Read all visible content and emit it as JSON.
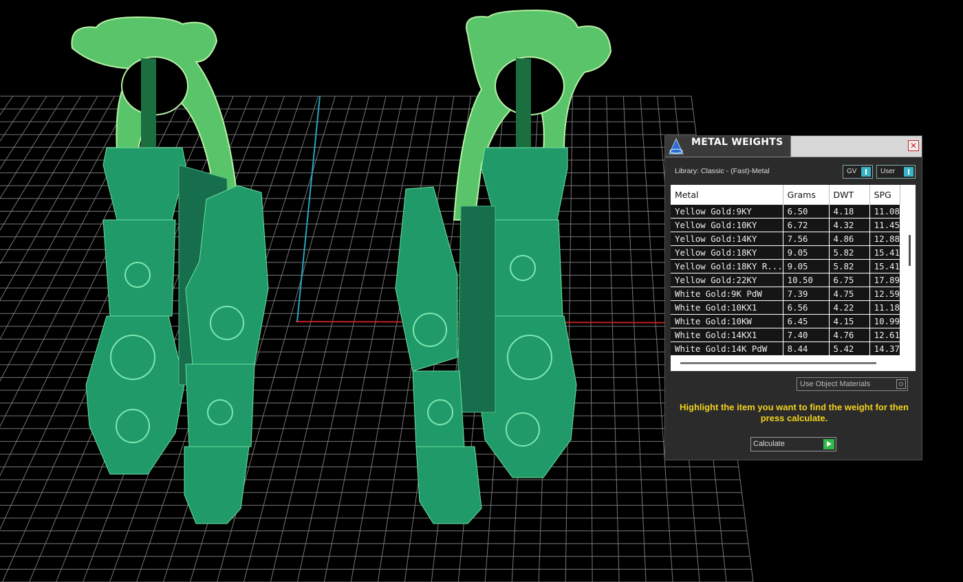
{
  "panel": {
    "title": "METAL WEIGHTS",
    "close_glyph": "✕",
    "library_label": "Library: Classic - (Fast)-Metal",
    "gv_label": "GV",
    "user_label": "User",
    "columns": [
      "Metal",
      "Grams",
      "DWT",
      "SPG"
    ],
    "rows": [
      {
        "metal": "Yellow Gold:9KY",
        "grams": "6.50",
        "dwt": "4.18",
        "spg": "11.08"
      },
      {
        "metal": "Yellow Gold:10KY",
        "grams": "6.72",
        "dwt": "4.32",
        "spg": "11.45"
      },
      {
        "metal": "Yellow Gold:14KY",
        "grams": "7.56",
        "dwt": "4.86",
        "spg": "12.88"
      },
      {
        "metal": "Yellow Gold:18KY",
        "grams": "9.05",
        "dwt": "5.82",
        "spg": "15.41"
      },
      {
        "metal": "Yellow Gold:18KY R...",
        "grams": "9.05",
        "dwt": "5.82",
        "spg": "15.41"
      },
      {
        "metal": "Yellow Gold:22KY",
        "grams": "10.50",
        "dwt": "6.75",
        "spg": "17.89"
      },
      {
        "metal": "White Gold:9K PdW",
        "grams": "7.39",
        "dwt": "4.75",
        "spg": "12.59"
      },
      {
        "metal": "White Gold:10KX1",
        "grams": "6.56",
        "dwt": "4.22",
        "spg": "11.18"
      },
      {
        "metal": "White Gold:10KW",
        "grams": "6.45",
        "dwt": "4.15",
        "spg": "10.99"
      },
      {
        "metal": "White Gold:14KX1",
        "grams": "7.40",
        "dwt": "4.76",
        "spg": "12.61"
      },
      {
        "metal": "White Gold:14K PdW",
        "grams": "8.44",
        "dwt": "5.42",
        "spg": "14.37"
      }
    ],
    "use_object_materials_label": "Use Object Materials",
    "hint": "Highlight the item you want to find the weight for then press calculate.",
    "calculate_label": "Calculate"
  },
  "colors": {
    "grid": "#8c8c8c",
    "axis_x": "#c0201c",
    "axis_y": "#2aa6c0",
    "model_body": "#1f9a68",
    "model_highlight": "#6fd37a",
    "hint_text": "#f2d21f"
  }
}
